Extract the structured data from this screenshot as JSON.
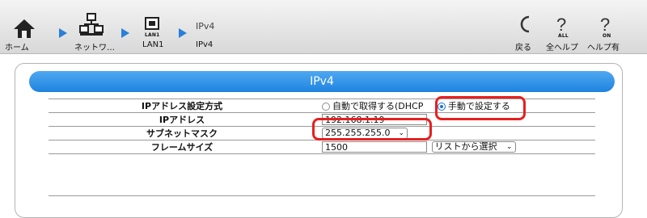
{
  "breadcrumb": {
    "home_label": "ホーム",
    "network_label": "ネットワ…",
    "lan_label": "LAN1",
    "lan_icon_sub": "LAN1",
    "current_title": "IPv4",
    "current_label": "IPv4"
  },
  "toolbar": {
    "back_label": "戻る",
    "help_all_label": "全ヘルプ",
    "help_all_sub": "ALL",
    "help_on_label": "ヘルプ有",
    "help_on_sub": "ON"
  },
  "panel": {
    "title": "IPv4",
    "rows": [
      {
        "label": "IPアドレス設定方式",
        "option_auto": "自動で取得する(DHCP",
        "option_manual": "手動で設定する",
        "selected": "manual"
      },
      {
        "label": "IPアドレス",
        "value": "192.168.1.19"
      },
      {
        "label": "サブネットマスク",
        "value": "255.255.255.0"
      },
      {
        "label": "フレームサイズ",
        "value": "1500",
        "select_label": "リストから選択"
      }
    ]
  },
  "colors": {
    "accent": "#1e83df",
    "highlight": "#e62020"
  }
}
